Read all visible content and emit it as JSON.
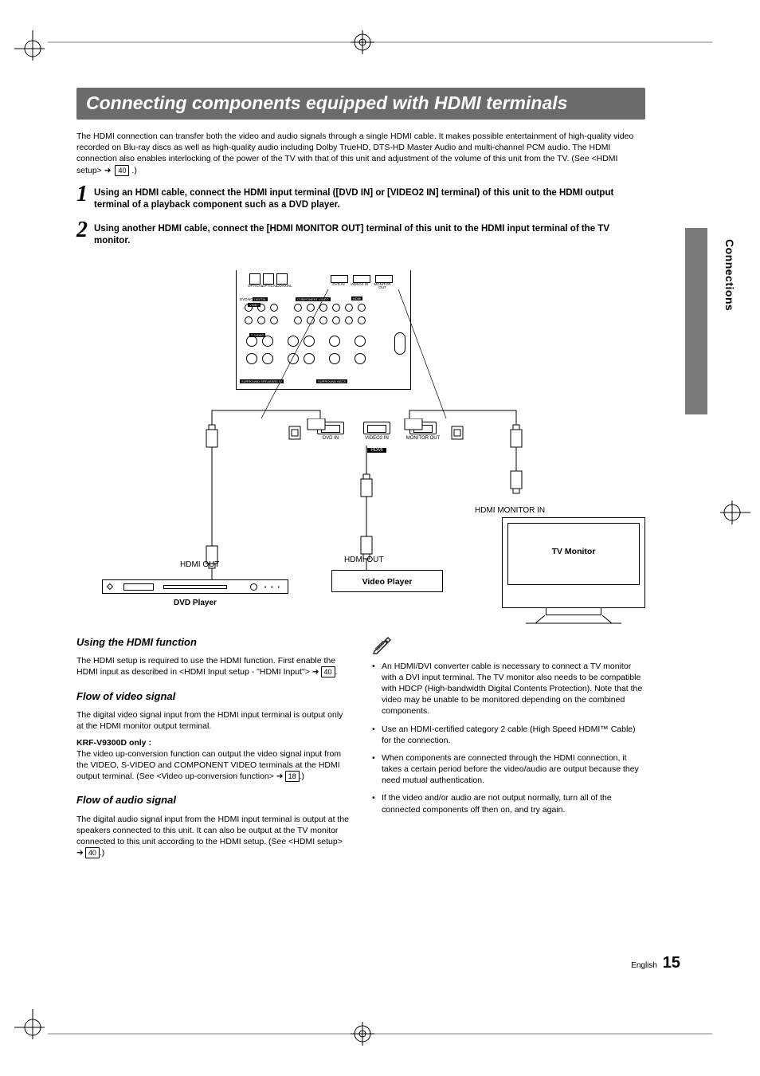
{
  "title": "Connecting components equipped with HDMI terminals",
  "intro_a": "The HDMI connection can transfer both the video and audio signals through a single HDMI cable. It makes possible entertainment of high-quality video recorded on Blu-ray discs as well as high-quality audio including Dolby TrueHD, DTS-HD Master Audio and multi-channel PCM audio. The HDMI connection also enables interlocking of the power of the TV with that of this unit and adjustment of the volume of this unit from the TV. (See <HDMI setup> ➜",
  "intro_ref": "40",
  "intro_b": ".)",
  "step1_num": "1",
  "step1": "Using an HDMI cable, connect the HDMI input terminal ([DVD IN] or [VIDEO2 IN] terminal) of this unit to the HDMI output terminal of a playback component such as a DVD player.",
  "step2_num": "2",
  "step2": "Using another HDMI cable, connect the [HDMI MONITOR OUT] terminal of this unit to the HDMI input terminal of the TV monitor.",
  "side_label": "Connections",
  "rear": {
    "optical": "OPTICAL",
    "coaxial": "COAXIAL",
    "digital": "DIGITAL",
    "dvd_in": "DVD IN",
    "video2_in": "VIDEO2 IN",
    "monitor_out": "MONITOR OUT",
    "hdmi": "HDMI",
    "video": "VIDEO",
    "svideo": "S-VIDEO",
    "component": "COMPONENT VIDEO",
    "surround": "SURROUND SPEAKERS W",
    "surround_back": "SURROUND BACK",
    "dvd1": "DVD/6CH"
  },
  "hdmi_close": {
    "dvd_in": "DVD IN",
    "video2_in": "VIDEO2 IN",
    "monitor_out": "MONITOR OUT",
    "bar": "HDMI"
  },
  "labels": {
    "hdmi_out_l": "HDMI OUT",
    "hdmi_out_r": "HDMI OUT",
    "hdmi_monitor_in": "HDMI MONITOR IN",
    "dvd_player": "DVD Player",
    "video_player": "Video Player",
    "tv_monitor": "TV Monitor"
  },
  "left_col": {
    "h1": "Using the HDMI function",
    "p1a": "The HDMI setup is required to use the HDMI function. First enable the HDMI input as described in <HDMI Input setup - \"HDMI Input\"> ➜",
    "p1ref": "40",
    "p1b": ".",
    "h2": "Flow of video signal",
    "p2": "The digital video signal input from the HDMI input terminal is output only at the HDMI monitor output terminal.",
    "p2b_label": "KRF-V9300D only :",
    "p2b_a": "The video up-conversion function can output the video signal input from the VIDEO, S-VIDEO and COMPONENT VIDEO terminals at the HDMI output terminal. (See <Video up-conversion function> ➜",
    "p2b_ref": "18",
    "p2b_b": ".)",
    "h3": "Flow of audio signal",
    "p3a": "The digital audio signal input from the HDMI input terminal is output at the speakers connected to this unit. It can also be output at the TV monitor connected to this unit according to the HDMI setup. (See <HDMI setup> ➜",
    "p3ref": "40",
    "p3b": ".)"
  },
  "right_col": {
    "li1": "An HDMI/DVI converter cable is necessary to connect a TV monitor with a DVI input terminal. The TV monitor also needs to be compatible with HDCP (High-bandwidth Digital Contents Protection). Note that the video may be unable to be monitored depending on the combined components.",
    "li2": "Use an HDMI-certified category 2 cable (High Speed HDMI™ Cable) for the connection.",
    "li3": "When components are connected through the HDMI connection, it takes a certain period before the video/audio are output because they need mutual authentication.",
    "li4": "If the video and/or audio are not output normally, turn all of the connected components off then on, and try again."
  },
  "footer": {
    "lang": "English",
    "page": "15"
  }
}
